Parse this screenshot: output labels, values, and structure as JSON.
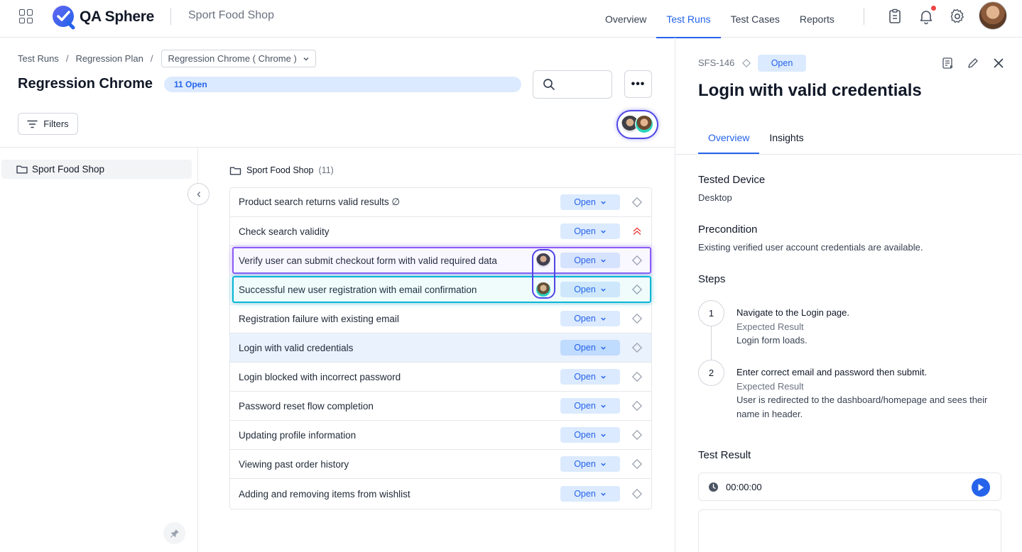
{
  "app": {
    "name": "QA Sphere",
    "project": "Sport Food Shop"
  },
  "nav": {
    "links": [
      {
        "label": "Overview",
        "active": false
      },
      {
        "label": "Test Runs",
        "active": true
      },
      {
        "label": "Test Cases",
        "active": false
      },
      {
        "label": "Reports",
        "active": false
      }
    ],
    "icons": [
      "clipboard-icon",
      "bell-icon",
      "gear-icon"
    ],
    "notification_dot_color": "#ef4444"
  },
  "breadcrumb": {
    "items": [
      "Test Runs",
      "Regression Plan"
    ],
    "current_select": "Regression Chrome ( Chrome )"
  },
  "run": {
    "title": "Regression Chrome",
    "open_count_label": "11 Open",
    "open_fraction": 1.0
  },
  "toolbar": {
    "search_placeholder": "",
    "more_label": "•••",
    "filters_label": "Filters"
  },
  "sidebar": {
    "folder": "Sport Food Shop"
  },
  "folder_header": {
    "name": "Sport Food Shop",
    "count": "(11)"
  },
  "cases": [
    {
      "title": "Product search returns valid results ∅",
      "status": "Open",
      "priority": "none"
    },
    {
      "title": "Check search validity",
      "status": "Open",
      "priority": "high"
    },
    {
      "title": "Verify user can submit checkout form with valid required data",
      "status": "Open",
      "priority": "none",
      "assignee": "dark"
    },
    {
      "title": "Successful new user registration with email confirmation",
      "status": "Open",
      "priority": "none",
      "assignee": "teal"
    },
    {
      "title": "Registration failure with existing email",
      "status": "Open",
      "priority": "none"
    },
    {
      "title": "Login with valid credentials",
      "status": "Open",
      "priority": "none",
      "selected": true
    },
    {
      "title": "Login blocked with incorrect password",
      "status": "Open",
      "priority": "none"
    },
    {
      "title": "Password reset flow completion",
      "status": "Open",
      "priority": "none"
    },
    {
      "title": "Updating profile information",
      "status": "Open",
      "priority": "none"
    },
    {
      "title": "Viewing past order history",
      "status": "Open",
      "priority": "none"
    },
    {
      "title": "Adding and removing items from wishlist",
      "status": "Open",
      "priority": "none"
    }
  ],
  "detail": {
    "id": "SFS-146",
    "status": "Open",
    "title": "Login with valid credentials",
    "tabs": [
      {
        "label": "Overview",
        "active": true
      },
      {
        "label": "Insights",
        "active": false
      }
    ],
    "tested_device_label": "Tested Device",
    "tested_device": "Desktop",
    "precondition_label": "Precondition",
    "precondition": "Existing verified user account credentials are available.",
    "steps_label": "Steps",
    "steps": [
      {
        "num": "1",
        "action": "Navigate to the Login page.",
        "expected_label": "Expected Result",
        "expected": "Login form loads."
      },
      {
        "num": "2",
        "action": "Enter correct email and password then submit.",
        "expected_label": "Expected Result",
        "expected": "User is redirected to the dashboard/homepage and sees their name in header."
      }
    ],
    "test_result_label": "Test Result",
    "timer": "00:00:00"
  },
  "colors": {
    "accent": "#2563eb",
    "status_bg": "#dbeafe",
    "highlight_purple": "#8b5cf6",
    "highlight_cyan": "#06b6d4",
    "priority_high": "#ef4444"
  }
}
